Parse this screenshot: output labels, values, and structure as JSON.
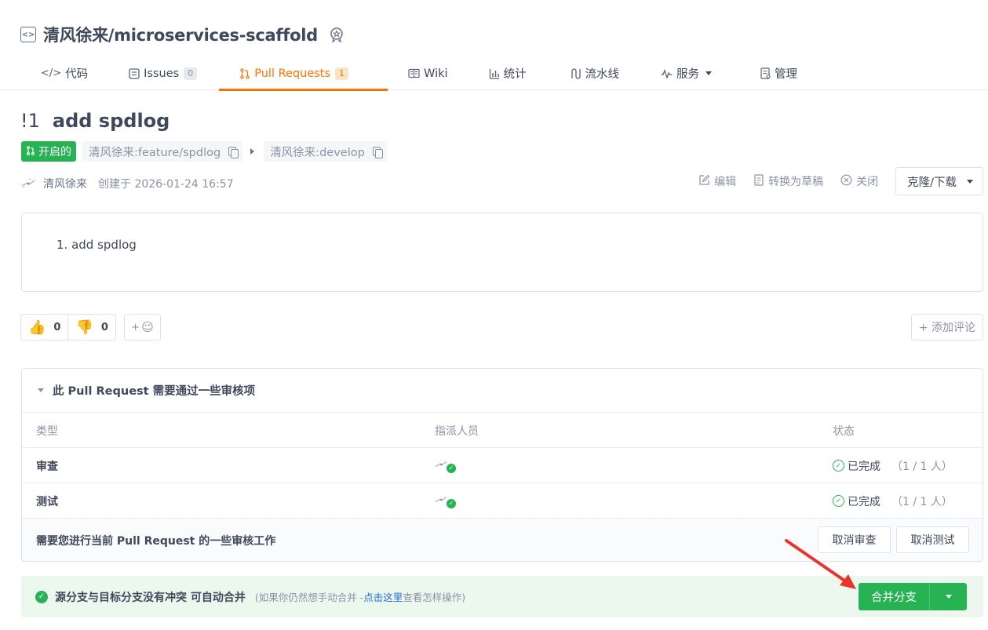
{
  "repo": {
    "title": "清风徐来/microservices-scaffold"
  },
  "tabs": [
    {
      "label": "代码",
      "icon": "code-icon",
      "count": ""
    },
    {
      "label": "Issues",
      "icon": "issues-icon",
      "count": "0"
    },
    {
      "label": "Pull Requests",
      "icon": "pull-request-icon",
      "count": "1",
      "active": true
    },
    {
      "label": "Wiki",
      "icon": "wiki-icon",
      "count": ""
    },
    {
      "label": "统计",
      "icon": "stats-icon",
      "count": ""
    },
    {
      "label": "流水线",
      "icon": "pipeline-icon",
      "count": ""
    },
    {
      "label": "服务",
      "icon": "service-icon",
      "count": ""
    },
    {
      "label": "管理",
      "icon": "manage-icon",
      "count": ""
    }
  ],
  "pr": {
    "number": "!1",
    "title": "add spdlog",
    "status": "开启的",
    "source_branch": "清风徐来:feature/spdlog",
    "target_branch": "清风徐来:develop",
    "author": "清风徐来",
    "created": "创建于 2026-01-24 16:57",
    "description_item": "1. add spdlog"
  },
  "actions": {
    "edit": "编辑",
    "draft": "转换为草稿",
    "close": "关闭",
    "clone": "克隆/下载"
  },
  "reactions": {
    "thumbs_up": "0",
    "thumbs_down": "0",
    "add_emoji": "+",
    "add_comment": "+ 添加评论"
  },
  "review": {
    "header": "此 Pull Request 需要通过一些审核项",
    "columns": [
      "类型",
      "指派人员",
      "状态"
    ],
    "rows": [
      {
        "type": "审查",
        "status": "已完成",
        "count": "（1 / 1 人）"
      },
      {
        "type": "测试",
        "status": "已完成",
        "count": "（1 / 1 人）"
      }
    ],
    "footer_msg": "需要您进行当前 Pull Request 的一些审核工作",
    "cancel_review": "取消审查",
    "cancel_test": "取消测试"
  },
  "merge": {
    "message": "源分支与目标分支没有冲突 可自动合并",
    "hint_prefix": "(如果你仍然想手动合并 - ",
    "hint_link": "点击这里",
    "hint_suffix": " 查看怎样操作)",
    "button": "合并分支"
  },
  "colors": {
    "accent": "#fe7300",
    "success": "#27b254",
    "annotation": "#e8352b"
  }
}
